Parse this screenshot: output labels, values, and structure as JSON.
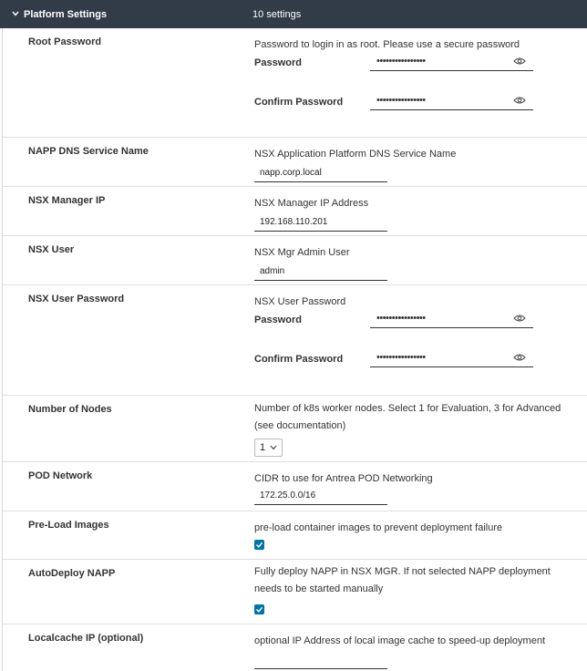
{
  "header": {
    "title": "Platform Settings",
    "count": "10 settings",
    "chevron_icon": "chevron-down-icon",
    "background": "#313c48"
  },
  "colors": {
    "accent": "#0072a3"
  },
  "rows": {
    "root_password": {
      "label": "Root Password",
      "description": "Password to login in as root. Please use a secure password",
      "password_label": "Password",
      "password_value": "••••••••••••••••",
      "confirm_label": "Confirm Password",
      "confirm_value": "••••••••••••••••",
      "eye_icon": "eye-icon"
    },
    "napp_dns": {
      "label": "NAPP DNS Service Name",
      "description": "NSX Application Platform DNS Service Name",
      "value": "napp.corp.local"
    },
    "nsx_manager_ip": {
      "label": "NSX Manager IP",
      "description": "NSX Manager IP Address",
      "value": "192.168.110.201"
    },
    "nsx_user": {
      "label": "NSX User",
      "description": "NSX Mgr Admin User",
      "value": "admin"
    },
    "nsx_user_password": {
      "label": "NSX User Password",
      "description": "NSX User Password",
      "password_label": "Password",
      "password_value": "••••••••••••••••",
      "confirm_label": "Confirm Password",
      "confirm_value": "••••••••••••••••",
      "eye_icon": "eye-icon"
    },
    "number_of_nodes": {
      "label": "Number of Nodes",
      "description": "Number of k8s worker nodes. Select 1 for Evaluation, 3 for Advanced (see documentation)",
      "selected": "1"
    },
    "pod_network": {
      "label": "POD Network",
      "description": "CIDR to use for Antrea POD Networking",
      "value": "172.25.0.0/16"
    },
    "preload_images": {
      "label": "Pre-Load Images",
      "description": "pre-load container images to prevent deployment failure",
      "checked": true
    },
    "autodeploy_napp": {
      "label": "AutoDeploy NAPP",
      "description": "Fully deploy NAPP in NSX MGR. If not selected NAPP deployment needs to be started manually",
      "checked": true
    },
    "localcache_ip": {
      "label": "Localcache IP (optional)",
      "description": "optional IP Address of local image cache to speed-up deployment",
      "value": ""
    }
  }
}
